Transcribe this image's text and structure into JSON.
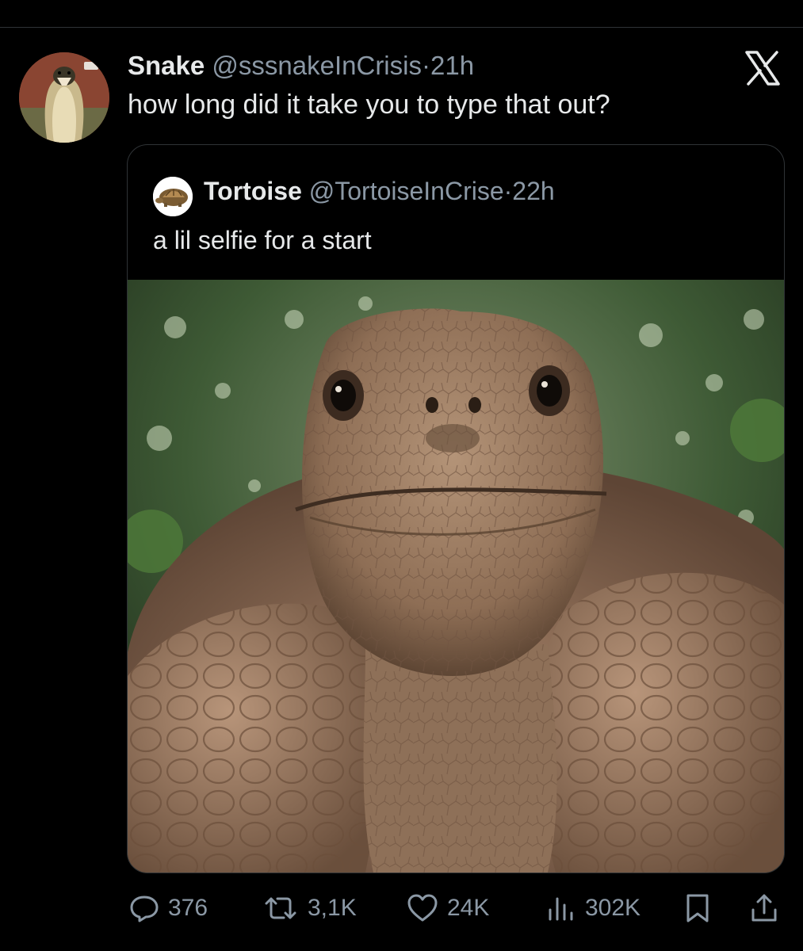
{
  "tweet": {
    "display_name": "Snake",
    "handle": "@sssnakeInCrisis",
    "separator": "·",
    "time": "21h",
    "text": "how long did it take you to type that out?",
    "avatar_icon": "cobra-avatar"
  },
  "quoted": {
    "display_name": "Tortoise",
    "handle": "@TortoiseInCrise",
    "separator": "·",
    "time": "22h",
    "text": "a lil selfie for a start",
    "avatar_icon": "tortoise-avatar",
    "media": "tortoise-closeup-photo"
  },
  "actions": {
    "replies": "376",
    "reposts": "3,1K",
    "likes": "24K",
    "views": "302K"
  },
  "icons": {
    "reply": "reply-icon",
    "repost": "repost-icon",
    "like": "heart-icon",
    "views": "views-icon",
    "bookmark": "bookmark-icon",
    "share": "share-icon",
    "brand": "x-logo-icon"
  },
  "colors": {
    "background": "#000000",
    "primary_text": "#e7e9ea",
    "secondary_text": "#8b98a5",
    "divider": "#2f3336"
  }
}
